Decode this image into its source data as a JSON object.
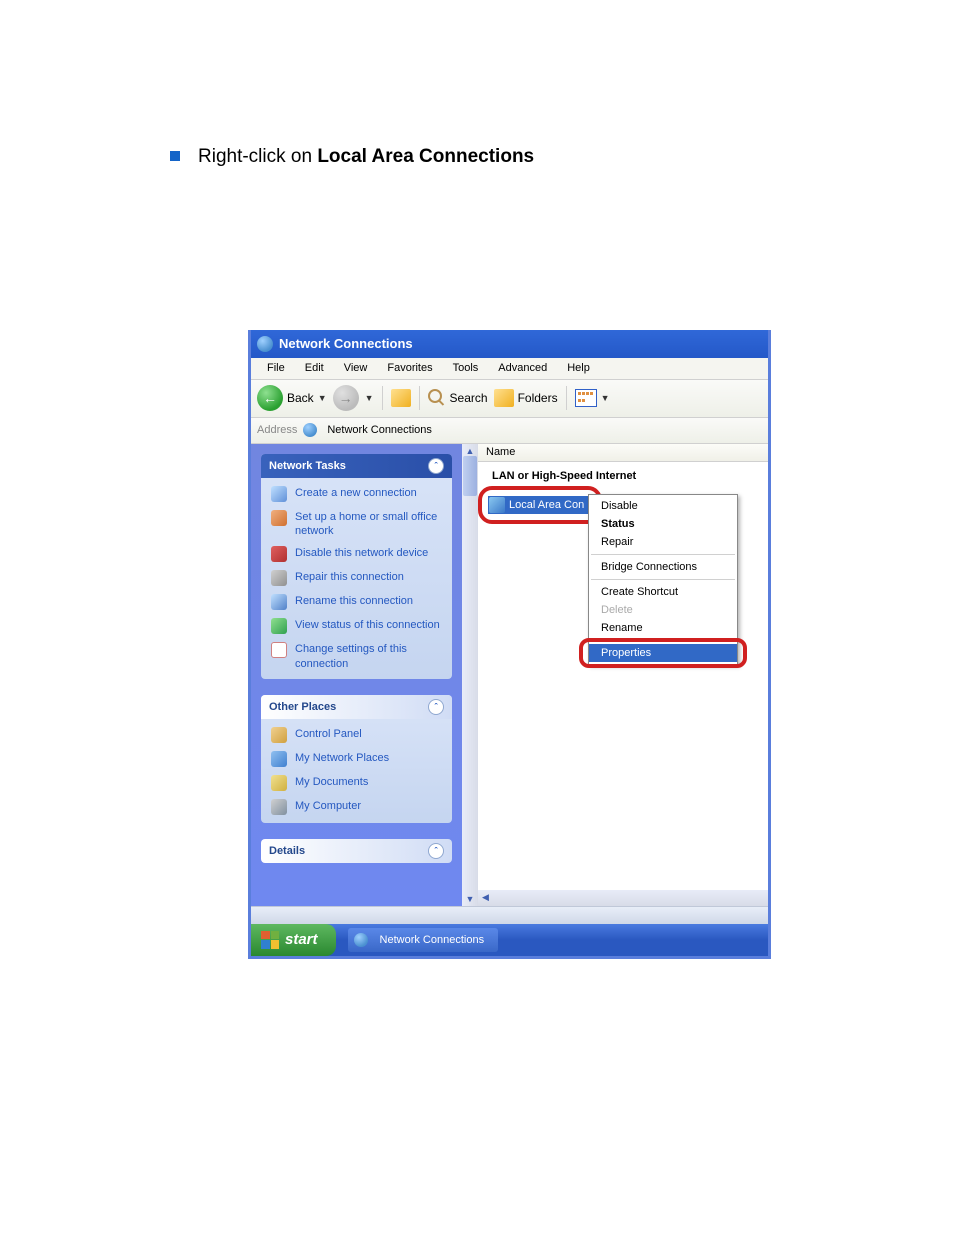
{
  "instruction": {
    "prefix": "Right-click on ",
    "bold": "Local Area Connections"
  },
  "window": {
    "title": "Network Connections"
  },
  "menubar": [
    "File",
    "Edit",
    "View",
    "Favorites",
    "Tools",
    "Advanced",
    "Help"
  ],
  "toolbar": {
    "back": "Back",
    "search": "Search",
    "folders": "Folders"
  },
  "addressbar": {
    "label": "Address",
    "value": "Network Connections"
  },
  "sidebar": {
    "tasks_header": "Network Tasks",
    "tasks": [
      "Create a new connection",
      "Set up a home or small office network",
      "Disable this network device",
      "Repair this connection",
      "Rename this connection",
      "View status of this connection",
      "Change settings of this connection"
    ],
    "places_header": "Other Places",
    "places": [
      "Control Panel",
      "My Network Places",
      "My Documents",
      "My Computer"
    ],
    "details_header": "Details"
  },
  "content": {
    "column": "Name",
    "group": "LAN or High-Speed Internet",
    "item": "Local Area Con"
  },
  "context_menu": {
    "disable": "Disable",
    "status": "Status",
    "repair": "Repair",
    "bridge": "Bridge Connections",
    "shortcut": "Create Shortcut",
    "delete": "Delete",
    "rename": "Rename",
    "properties": "Properties"
  },
  "taskbar": {
    "start": "start",
    "task1": "Network Connections"
  }
}
